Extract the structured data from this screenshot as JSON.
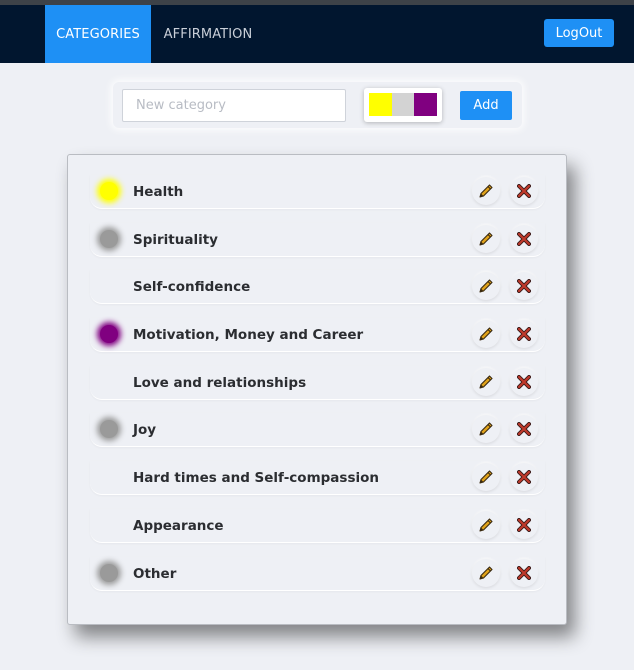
{
  "nav": {
    "tabs": [
      {
        "label": "CATEGORIES",
        "active": true
      },
      {
        "label": "AFFIRMATION",
        "active": false
      }
    ],
    "logout_label": "LogOut"
  },
  "add_form": {
    "placeholder": "New category",
    "value": "",
    "colors": [
      "#ffff00",
      "#d3d3d3",
      "#800080"
    ],
    "add_label": "Add"
  },
  "categories": [
    {
      "label": "Health",
      "color": "#ffff00"
    },
    {
      "label": "Spirituality",
      "color": "#9a9a9a"
    },
    {
      "label": "Self-confidence",
      "color": null
    },
    {
      "label": "Motivation, Money and Career",
      "color": "#800080"
    },
    {
      "label": "Love and relationships",
      "color": null
    },
    {
      "label": "Joy",
      "color": "#9a9a9a"
    },
    {
      "label": "Hard times and Self-compassion",
      "color": null
    },
    {
      "label": "Appearance",
      "color": null
    },
    {
      "label": "Other",
      "color": "#9a9a9a"
    }
  ],
  "icons": {
    "edit": "pencil-icon",
    "delete": "close-x-icon"
  },
  "colors": {
    "nav_bg": "#01162f",
    "accent": "#1e90f5",
    "page_bg": "#eef0f5",
    "pencil": "#e0a21a",
    "delete": "#c0392b"
  }
}
